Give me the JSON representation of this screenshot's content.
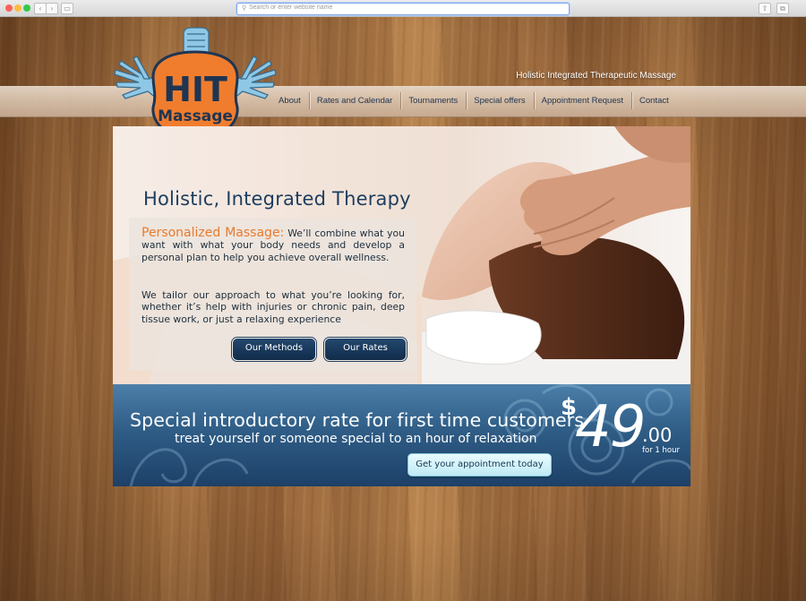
{
  "browser": {
    "address_placeholder": "Search or enter website name",
    "back_glyph": "‹",
    "forward_glyph": "›",
    "sidebar_glyph": "▭",
    "share_glyph": "⇧",
    "tabs_glyph": "⧉"
  },
  "site": {
    "logo": {
      "line1": "HIT",
      "line2": "Massage",
      "brand_orange": "#f07d2e",
      "brand_blue": "#8fc8e6"
    },
    "tagline": "Holistic Integrated Therapeutic Massage",
    "nav": [
      {
        "label": "About"
      },
      {
        "label": "Rates and Calendar"
      },
      {
        "label": "Tournaments"
      },
      {
        "label": "Special offers"
      },
      {
        "label": "Appointment Request"
      },
      {
        "label": "Contact"
      }
    ]
  },
  "hero": {
    "title": "Holistic, Integrated Therapy",
    "lead": "Personalized Massage:",
    "para1_rest": " We’ll combine what you want with what your body needs and develop a personal plan to help you achieve overall wellness.",
    "para2": "We tailor our approach to what you’re looking for, whether it’s help with injuries or chronic pain, deep tissue work, or just a relaxing experience",
    "btn_methods": "Our Methods",
    "btn_rates": "Our Rates",
    "accent_color": "#e87a2d",
    "title_color": "#1e3e60"
  },
  "promo": {
    "line1": "Special introductory rate for first time customers",
    "line2": "treat yourself or someone special to an hour of relaxation",
    "price_symbol": "$",
    "price_whole": "49",
    "price_cents": ".00",
    "price_unit": "for 1 hour",
    "cta": "Get your appointment today"
  }
}
